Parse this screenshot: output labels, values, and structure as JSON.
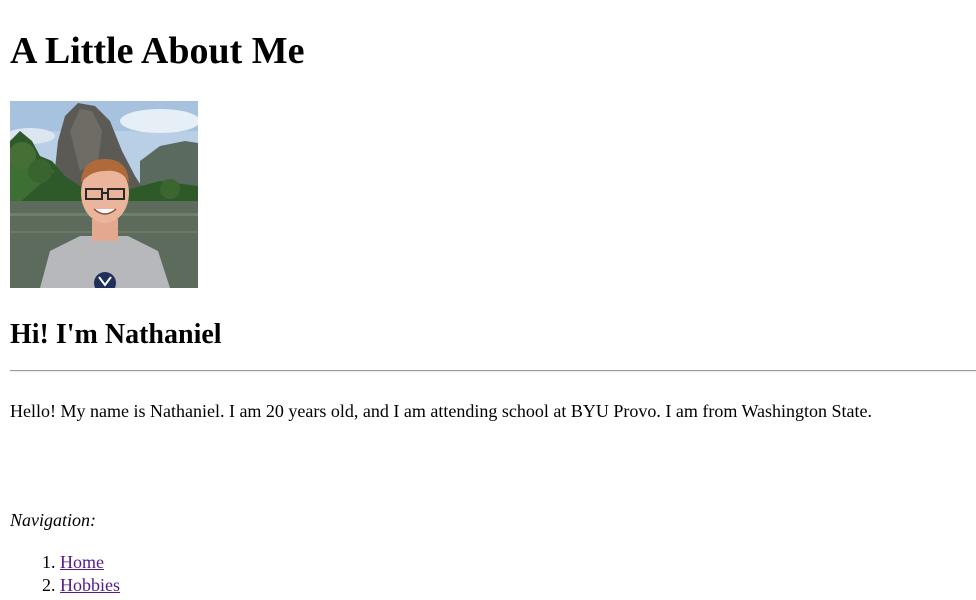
{
  "page": {
    "heading": "A Little About Me",
    "greeting": "Hi! I'm Nathaniel",
    "intro": "Hello! My name is Nathaniel. I am 20 years old, and I am attending school at BYU Provo. I am from Washington State."
  },
  "navigation": {
    "label": "Navigation:",
    "items": [
      {
        "label": "Home"
      },
      {
        "label": "Hobbies"
      }
    ]
  },
  "colors": {
    "visited_link": "#551a8b",
    "text": "#000000",
    "background": "#ffffff"
  }
}
